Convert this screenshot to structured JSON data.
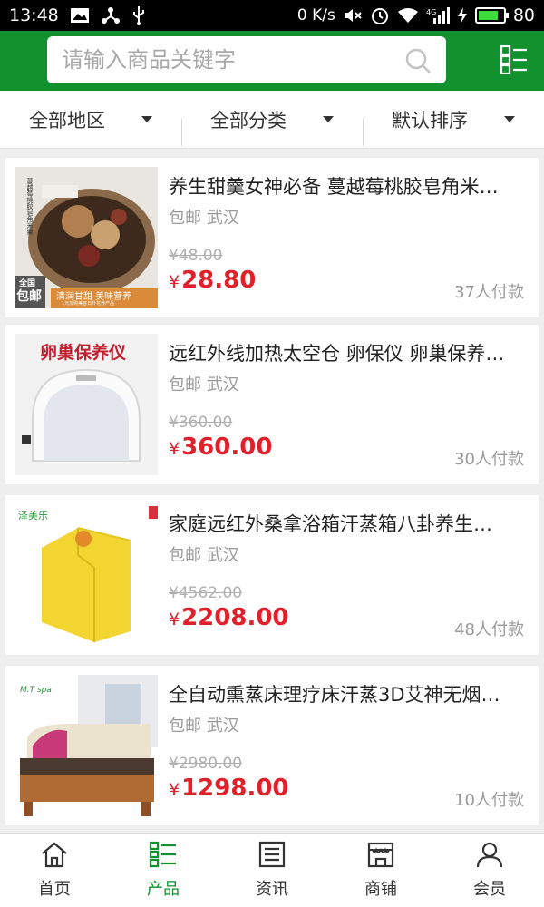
{
  "statusbar": {
    "time": "13:48",
    "speed": "0 K/s",
    "battery": "80",
    "network": "4G"
  },
  "search": {
    "placeholder": "请输入商品关键字"
  },
  "filters": [
    {
      "label": "全部地区"
    },
    {
      "label": "全部分类"
    },
    {
      "label": "默认排序"
    }
  ],
  "products": [
    {
      "title": "养生甜羹女神必备 蔓越莓桃胶皂角米…",
      "meta": "包邮 武汉",
      "old_price": "¥48.00",
      "price_symbol": "¥",
      "price": "28.80",
      "sales": "37人付款",
      "image_texts": {
        "badge_top": "全国",
        "badge": "包邮",
        "banner": "清润甘甜 美味营养",
        "banner_sub": "1元加购美容日升花养产品",
        "vertical": "蔓越莓桃胶皂角米羹"
      }
    },
    {
      "title": "远红外线加热太空仓 卵保仪 卵巢保养…",
      "meta": "包邮 武汉",
      "old_price": "¥360.00",
      "price_symbol": "¥",
      "price": "360.00",
      "sales": "30人付款",
      "image_texts": {
        "heading": "卵巢保养仪"
      }
    },
    {
      "title": "家庭远红外桑拿浴箱汗蒸箱八卦养生…",
      "meta": "包邮 武汉",
      "old_price": "¥4562.00",
      "price_symbol": "¥",
      "price": "2208.00",
      "sales": "48人付款",
      "image_texts": {
        "brand": "泽美乐"
      }
    },
    {
      "title": "全自动熏蒸床理疗床汗蒸3D艾神无烟…",
      "meta": "包邮 武汉",
      "old_price": "¥2980.00",
      "price_symbol": "¥",
      "price": "1298.00",
      "sales": "10人付款",
      "image_texts": {
        "brand": "M.T spa"
      }
    }
  ],
  "tabs": [
    {
      "label": "首页",
      "icon": "home-icon"
    },
    {
      "label": "产品",
      "icon": "grid-list-icon"
    },
    {
      "label": "资讯",
      "icon": "news-icon"
    },
    {
      "label": "商铺",
      "icon": "shop-icon"
    },
    {
      "label": "会员",
      "icon": "user-icon"
    }
  ],
  "colors": {
    "brand_green": "#12922f",
    "price_red": "#e0202a"
  }
}
